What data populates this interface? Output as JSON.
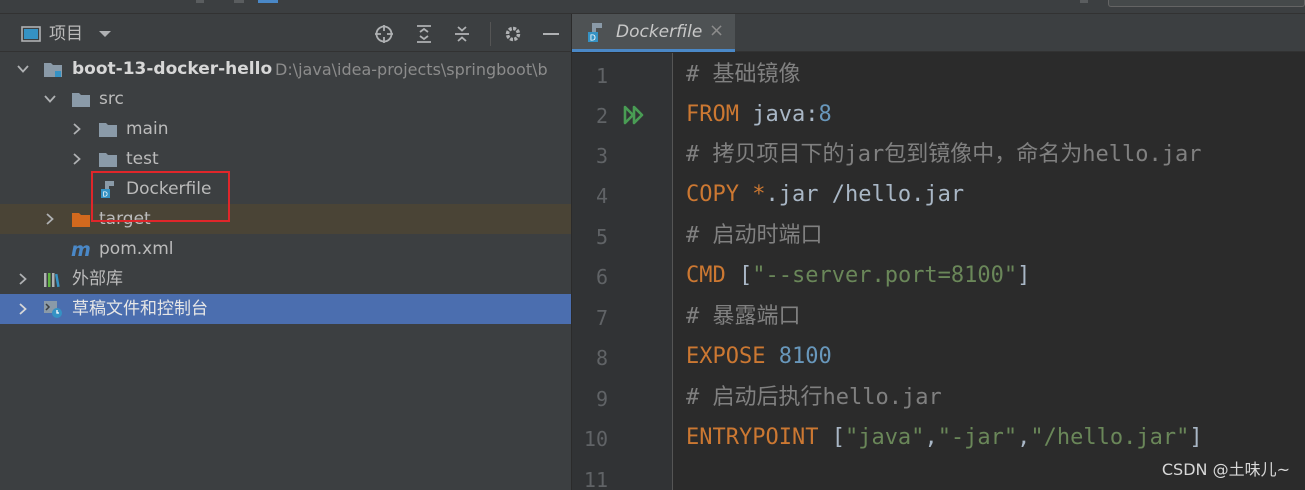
{
  "project_panel": {
    "title": "项目",
    "header_icons": [
      "panel-icon",
      "dropdown-caret-icon",
      "locate-icon",
      "expand-all-icon",
      "collapse-all-icon",
      "gear-icon",
      "minimize-icon"
    ],
    "tree": [
      {
        "label": "boot-13-docker-hello",
        "path": "D:\\java\\idea-projects\\springboot\\b",
        "icon": "module-folder-icon",
        "expanded": true
      },
      {
        "label": "src",
        "icon": "folder-icon",
        "expanded": true
      },
      {
        "label": "main",
        "icon": "folder-icon",
        "expanded": false
      },
      {
        "label": "test",
        "icon": "folder-icon",
        "expanded": false
      },
      {
        "label": "Dockerfile",
        "icon": "dockerfile-icon"
      },
      {
        "label": "target",
        "icon": "excluded-folder-icon",
        "expanded": false
      },
      {
        "label": "pom.xml",
        "icon": "maven-icon"
      },
      {
        "label": "外部库",
        "icon": "library-icon",
        "expanded": false
      },
      {
        "label": "草稿文件和控制台",
        "icon": "scratches-icon",
        "expanded": false
      }
    ]
  },
  "editor": {
    "tab": {
      "label": "Dockerfile",
      "close": "×"
    },
    "line_numbers": [
      "1",
      "2",
      "3",
      "4",
      "5",
      "6",
      "7",
      "8",
      "9",
      "10",
      "11"
    ],
    "lines": [
      "# 基础镜像",
      "FROM java:8",
      "# 拷贝项目下的jar包到镜像中，命名为hello.jar",
      "COPY *.jar /hello.jar",
      "# 启动时端口",
      "CMD [\"--server.port=8100\"]",
      "# 暴露端口",
      "EXPOSE 8100",
      "# 启动后执行hello.jar",
      "ENTRYPOINT [\"java\",\"-jar\",\"/hello.jar\"]",
      ""
    ]
  },
  "watermark": "CSDN @土味儿~",
  "colors": {
    "keyword": "#cc7832",
    "string": "#6a8759",
    "number": "#6897bb",
    "comment": "#808080",
    "selection_active": "#4b6eaf",
    "highlight_box": "#e0262a"
  }
}
